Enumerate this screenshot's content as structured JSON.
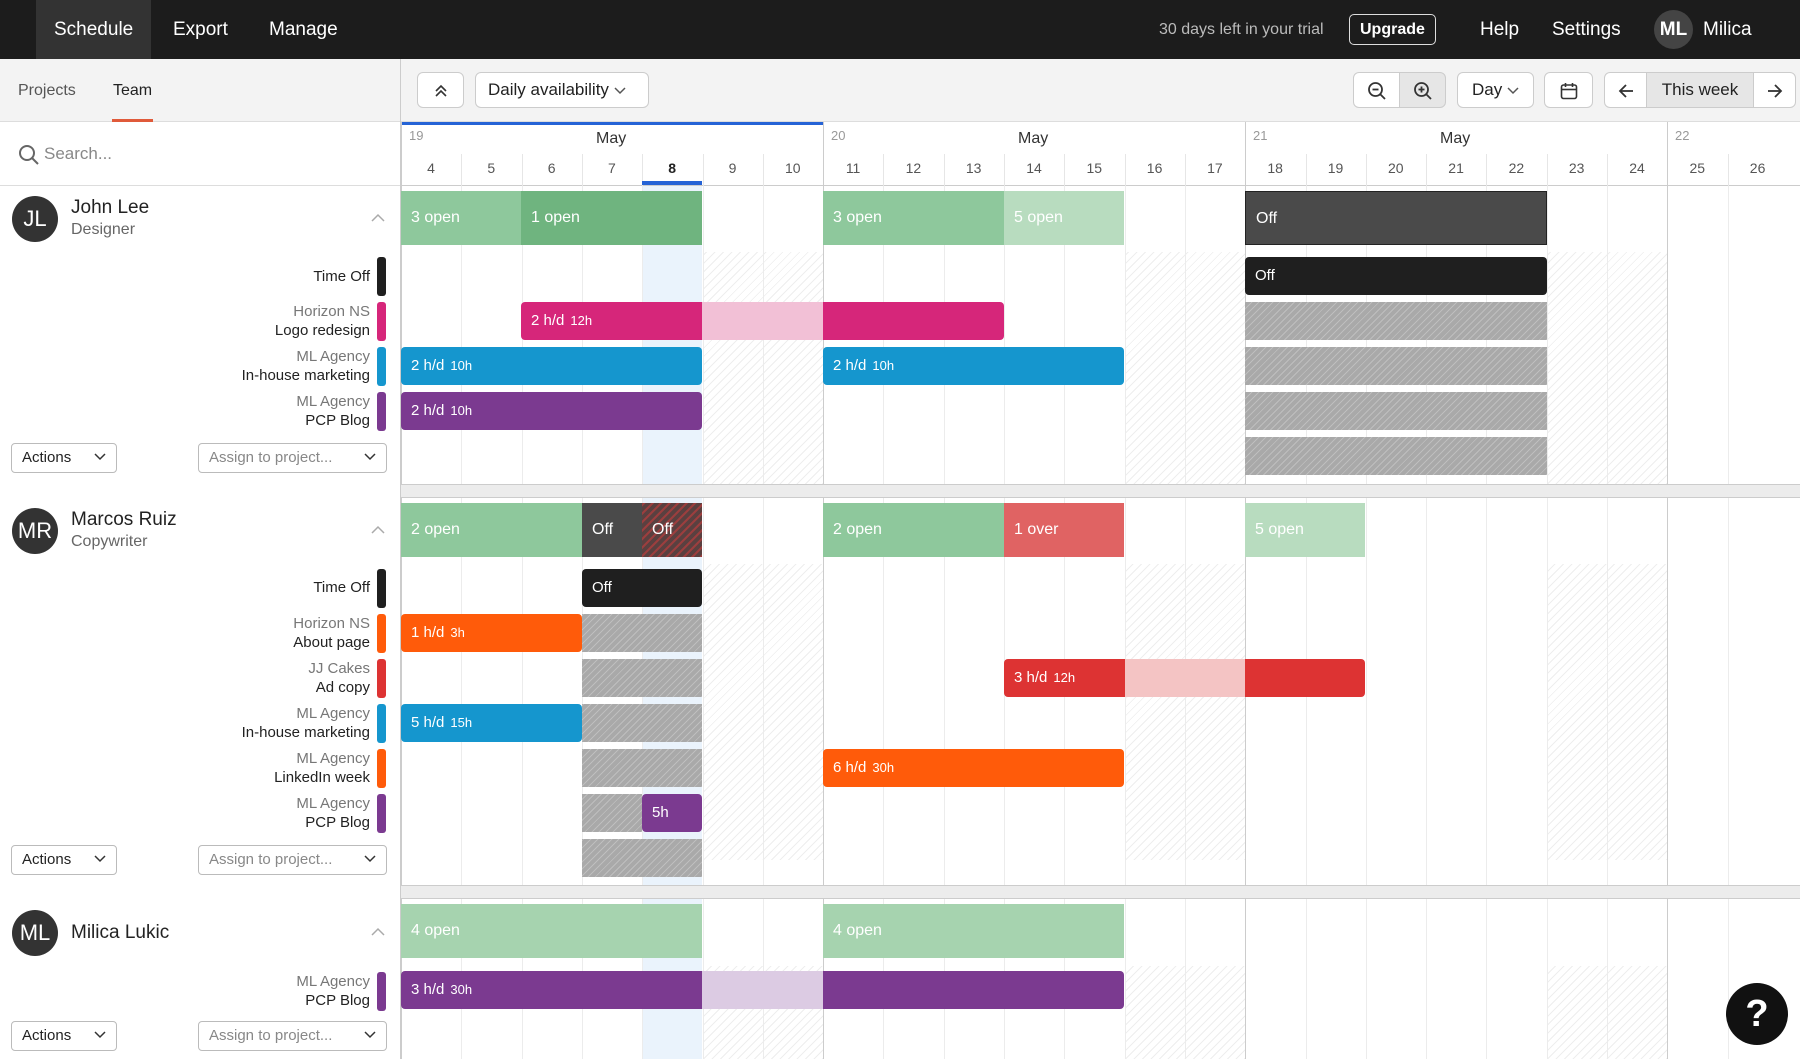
{
  "topnav": {
    "schedule": "Schedule",
    "export": "Export",
    "manage": "Manage",
    "trial": "30 days left in your trial",
    "upgrade": "Upgrade",
    "help": "Help",
    "settings": "Settings",
    "user_initials": "ML",
    "user_name": "Milica"
  },
  "lefttabs": {
    "projects": "Projects",
    "team": "Team"
  },
  "search": {
    "placeholder": "Search..."
  },
  "toolbar": {
    "view_select": "Daily availability",
    "scale": "Day",
    "this_week": "This week"
  },
  "calendar": {
    "weeks": [
      {
        "num": "19",
        "month": "May",
        "days": [
          "4",
          "5",
          "6",
          "7",
          "8",
          "9",
          "10"
        ]
      },
      {
        "num": "20",
        "month": "May",
        "days": [
          "11",
          "12",
          "13",
          "14",
          "15",
          "16",
          "17"
        ]
      },
      {
        "num": "21",
        "month": "May",
        "days": [
          "18",
          "19",
          "20",
          "21",
          "22",
          "23",
          "24"
        ]
      },
      {
        "num": "22",
        "month": "",
        "days": [
          "25",
          "26"
        ]
      }
    ],
    "today": "8"
  },
  "people": [
    {
      "initials": "JL",
      "name": "John Lee",
      "role": "Designer",
      "rows": [
        {
          "client": "",
          "project": "Time Off"
        },
        {
          "client": "Horizon NS",
          "project": "Logo redesign"
        },
        {
          "client": "ML Agency",
          "project": "In-house marketing"
        },
        {
          "client": "ML Agency",
          "project": "PCP Blog"
        }
      ],
      "actions": "Actions",
      "assign": "Assign to project..."
    },
    {
      "initials": "MR",
      "name": "Marcos Ruiz",
      "role": "Copywriter",
      "rows": [
        {
          "client": "",
          "project": "Time Off"
        },
        {
          "client": "Horizon NS",
          "project": "About page"
        },
        {
          "client": "JJ Cakes",
          "project": "Ad copy"
        },
        {
          "client": "ML Agency",
          "project": "In-house marketing"
        },
        {
          "client": "ML Agency",
          "project": "LinkedIn week"
        },
        {
          "client": "ML Agency",
          "project": "PCP Blog"
        }
      ],
      "actions": "Actions",
      "assign": "Assign to project..."
    },
    {
      "initials": "ML",
      "name": "Milica Lukic",
      "role": "",
      "rows": [
        {
          "client": "ML Agency",
          "project": "PCP Blog"
        }
      ],
      "actions": "Actions",
      "assign": "Assign to project..."
    }
  ],
  "bars": {
    "jl_sum": [
      "3 open",
      "1 open",
      "3 open",
      "5 open",
      "Off"
    ],
    "jl_timeoff": "Off",
    "jl_logo": {
      "rate": "2 h/d",
      "total": "12h"
    },
    "jl_inhouse1": {
      "rate": "2 h/d",
      "total": "10h"
    },
    "jl_inhouse2": {
      "rate": "2 h/d",
      "total": "10h"
    },
    "jl_pcp": {
      "rate": "2 h/d",
      "total": "10h"
    },
    "mr_sum": [
      "2 open",
      "Off",
      "Off",
      "2 open",
      "1 over",
      "5 open"
    ],
    "mr_timeoff": "Off",
    "mr_about": {
      "rate": "1 h/d",
      "total": "3h"
    },
    "mr_adcopy": {
      "rate": "3 h/d",
      "total": "12h"
    },
    "mr_inhouse": {
      "rate": "5 h/d",
      "total": "15h"
    },
    "mr_linkedin": {
      "rate": "6 h/d",
      "total": "30h"
    },
    "mr_pcp": "5h",
    "ml_sum": [
      "4 open",
      "4 open"
    ],
    "ml_pcp": {
      "rate": "3 h/d",
      "total": "30h"
    }
  },
  "help": "?",
  "colors": {
    "green": "#8ec89c",
    "green_dark": "#6fb47f",
    "green_light": "#b8dcbf",
    "magenta": "#d6267a",
    "blue": "#1596ce",
    "purple": "#7b3a90",
    "orange": "#ff5b0a",
    "red": "#dd3333",
    "over": "#e06363",
    "off": "#1f1f1f"
  }
}
